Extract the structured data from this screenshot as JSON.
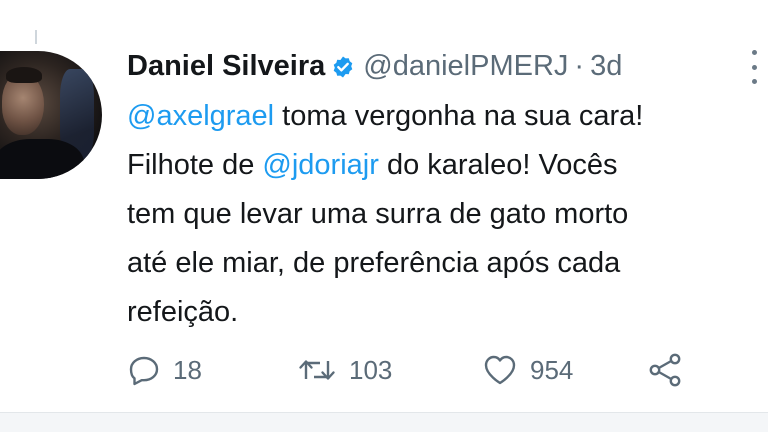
{
  "tweet": {
    "author_name": "Daniel Silveira",
    "author_handle": "@danielPMERJ",
    "separator": "·",
    "timestamp": "3d",
    "verified": true,
    "verified_icon": "verified-badge-icon",
    "more_icon": "more-options-icon",
    "text": {
      "line1_mention": "@axelgrael",
      "line1_rest": " toma vergonha na sua cara!",
      "line2_pre": "Filhote de ",
      "line2_mention": "@jdoriajr",
      "line2_rest": " do karaleo! Vocês",
      "line3": "tem que levar uma surra de gato morto",
      "line4": "até ele miar, de preferência após cada",
      "line5": "refeição."
    },
    "actions": {
      "reply_icon": "reply-icon",
      "reply_count": "18",
      "retweet_icon": "retweet-icon",
      "retweet_count": "103",
      "like_icon": "heart-icon",
      "like_count": "954",
      "share_icon": "share-icon"
    }
  },
  "colors": {
    "text": "#14171a",
    "secondary": "#5b6b78",
    "mention": "#1d9bf0",
    "verified": "#1d9bf0"
  }
}
